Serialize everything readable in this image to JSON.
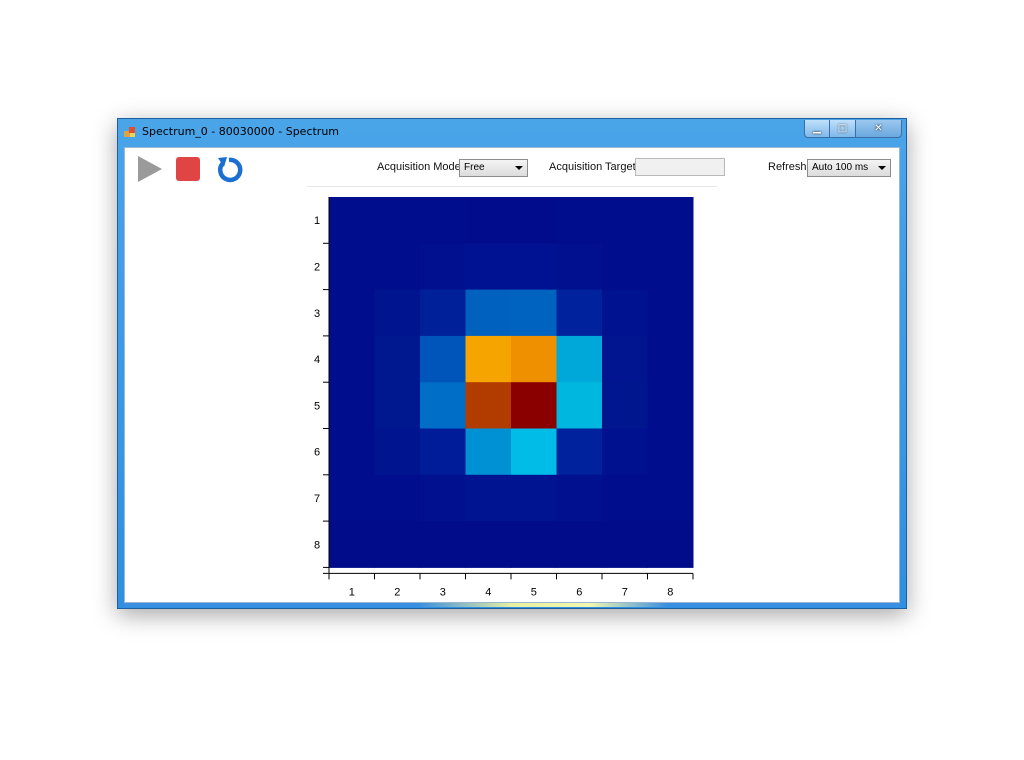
{
  "window": {
    "title": "Spectrum_0 - 80030000 - Spectrum",
    "icons": [
      "app-icon",
      "minimize-icon",
      "maximize-icon",
      "close-icon"
    ]
  },
  "toolbar": {
    "icons": [
      "play-icon",
      "stop-icon",
      "refresh-icon"
    ],
    "acquisition_mode_label": "Acquisition Mode",
    "acquisition_mode_value": "Free",
    "acquisition_target_label": "Acquisition Target",
    "acquisition_target_value": "",
    "refresh_label": "Refresh",
    "refresh_value": "Auto 100 ms"
  },
  "colors": {
    "play": "#9a9a9a",
    "stop": "#e04545",
    "refresh": "#1a6fd1",
    "titlebar": "#2f8fe0"
  },
  "chart_data": {
    "type": "heatmap",
    "x_ticks": [
      "1",
      "2",
      "3",
      "4",
      "5",
      "6",
      "7",
      "8"
    ],
    "y_ticks": [
      "1",
      "2",
      "3",
      "4",
      "5",
      "6",
      "7",
      "8"
    ],
    "colormap": "jet",
    "cells": [
      [
        "#000d8c",
        "#000d8c",
        "#000d8c",
        "#000c8c",
        "#000c8c",
        "#000d8c",
        "#000d8c",
        "#000d8c"
      ],
      [
        "#000d8c",
        "#000d8c",
        "#00108f",
        "#001291",
        "#001291",
        "#00108f",
        "#000d8c",
        "#000d8c"
      ],
      [
        "#000d8c",
        "#00148f",
        "#00209a",
        "#0062be",
        "#0063c0",
        "#00229c",
        "#00128f",
        "#000d8c"
      ],
      [
        "#000d8c",
        "#00188f",
        "#0055bb",
        "#f6a400",
        "#ef9000",
        "#00a8da",
        "#00158f",
        "#000d8c"
      ],
      [
        "#000d8c",
        "#00188f",
        "#006ec6",
        "#b23c00",
        "#8a0000",
        "#00b7e0",
        "#00168f",
        "#000d8c"
      ],
      [
        "#000d8c",
        "#00148f",
        "#001c98",
        "#0090d4",
        "#00bce6",
        "#00229c",
        "#00118f",
        "#000d8c"
      ],
      [
        "#000d8c",
        "#000d8c",
        "#00108f",
        "#001391",
        "#001391",
        "#00108f",
        "#000d8c",
        "#000d8c"
      ],
      [
        "#000c8a",
        "#000c8a",
        "#000c8a",
        "#000c8a",
        "#000c8a",
        "#000c8a",
        "#000c8a",
        "#000c8a"
      ]
    ]
  }
}
